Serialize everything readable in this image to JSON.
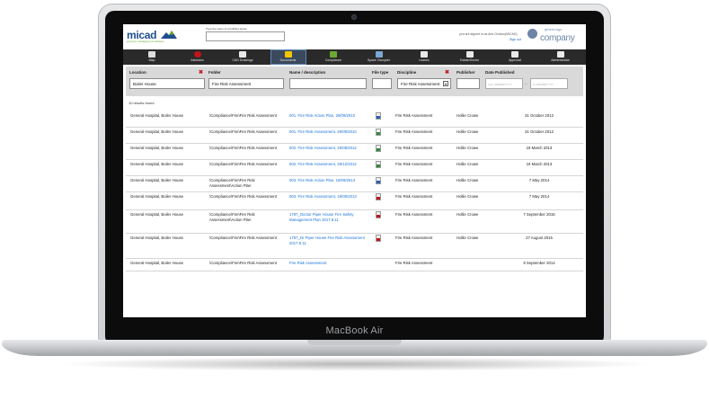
{
  "device": {
    "brand": "MacBook Air"
  },
  "app": {
    "logo_text": "micad",
    "logo_sub": "property management software",
    "search_label": "Type the name of a building below",
    "search_placeholder": "",
    "signed_in": "you are signed in as Ann Gordon(MICAD)",
    "sign_out": "Sign out",
    "company_small": "generic logo",
    "company_name": "company"
  },
  "nav": [
    {
      "label": "Map",
      "icon": "map-icon",
      "active": false
    },
    {
      "label": "Asbestos",
      "icon": "asbestos-icon",
      "active": false
    },
    {
      "label": "CAD Drawings",
      "icon": "cad-drawing-icon",
      "active": false
    },
    {
      "label": "Documents",
      "icon": "documents-icon",
      "active": true
    },
    {
      "label": "Compliance",
      "icon": "compliance-check-icon",
      "active": false
    },
    {
      "label": "Space Occupier",
      "icon": "space-occupier-icon",
      "active": false
    },
    {
      "label": "Leases",
      "icon": "leases-icon",
      "active": false
    },
    {
      "label": "Estate/Sector",
      "icon": "estate-sector-icon",
      "active": false
    },
    {
      "label": "Approval",
      "icon": "approval-icon",
      "active": false
    },
    {
      "label": "Administrator",
      "icon": "administrator-icon",
      "active": false
    }
  ],
  "filters": {
    "location_label": "Location",
    "location_value": "Boiler House",
    "folder_label": "Folder",
    "folder_value": "Fire Risk Assessment",
    "name_label": "Name / description",
    "name_value": "",
    "filetype_label": "File type",
    "filetype_value": "",
    "discipline_label": "Discipline",
    "discipline_value": "Fire Risk Assessment",
    "publisher_label": "Publisher",
    "publisher_value": "",
    "date_label": "Date Published",
    "date_from_placeholder": "from: DD/MM/YYYY",
    "date_to_placeholder": "to: DD/MM/YYYY"
  },
  "results_text": "10 results found",
  "rows": [
    {
      "location": "General Hospital, Boiler House",
      "folder": "\\Compliance\\Fire\\Fire Risk Assessment",
      "name": "001. Fire Risk Action Plan, 29/09/2010",
      "filetype": "word",
      "discipline": "Fire Risk Assessment",
      "publisher": "Hollie Crowe",
      "date": "31 October 2012"
    },
    {
      "location": "General Hospital, Boiler House",
      "folder": "\\Compliance\\Fire\\Fire Risk Assessment",
      "name": "001. Fire Risk Assessment, 29/09/2010",
      "filetype": "excel",
      "discipline": "Fire Risk Assessment",
      "publisher": "Hollie Crowe",
      "date": "31 October 2012"
    },
    {
      "location": "General Hospital, Boiler House",
      "folder": "\\Compliance\\Fire\\Fire Risk Assessment",
      "name": "002. Fire Risk Assessment, 29/09/2012",
      "filetype": "excel",
      "discipline": "Fire Risk Assessment",
      "publisher": "Hollie Crowe",
      "date": "19 March 2013"
    },
    {
      "location": "General Hospital, Boiler House",
      "folder": "\\Compliance\\Fire\\Fire Risk Assessment",
      "name": "002. Fire Risk Assessment, 28/12/2012",
      "filetype": "excel",
      "discipline": "Fire Risk Assessment",
      "publisher": "Hollie Crowe",
      "date": "19 March 2013"
    },
    {
      "location": "General Hospital, Boiler House",
      "folder": "\\Compliance\\Fire\\Fire Risk Assessment\\Action Plan",
      "name": "003. Fire Risk Action Plan, 19/09/2013",
      "filetype": "word",
      "discipline": "Fire Risk Assessment",
      "publisher": "Hollie Crowe",
      "date": "7 May 2014"
    },
    {
      "location": "General Hospital, Boiler House",
      "folder": "\\Compliance\\Fire\\Fire Risk Assessment",
      "name": "003. Fire Risk Assessment, 19/09/2013",
      "filetype": "pdf",
      "discipline": "Fire Risk Assessment",
      "publisher": "Hollie Crowe",
      "date": "7 May 2014"
    },
    {
      "location": "General Hospital, Boiler House",
      "folder": "\\Compliance\\Fire\\Fire Risk Assessment\\Action Plan",
      "name": "1787_Doctor Piper House Fire Safety Management Plan 2017.8.11",
      "filetype": "pdf",
      "discipline": "Fire Risk Assessment",
      "publisher": "Hollie Crowe",
      "date": "7 September 2015"
    },
    {
      "location": "General Hospital, Boiler House",
      "folder": "\\Compliance\\Fire\\Fire Risk Assessment",
      "name": "1787_Dr Piper House Fire Risk Assessment 2017.8.11",
      "filetype": "pdf",
      "discipline": "Fire Risk Assessment",
      "publisher": "Hollie Crowe",
      "date": "27 August 2015"
    },
    {
      "location": "General Hospital, Boiler House",
      "folder": "\\Compliance\\Fire\\Fire Risk Assessment",
      "name": "Fire Risk Assessment",
      "filetype": "none",
      "discipline": "Fire Risk Assessment",
      "publisher": "",
      "date": "9 September 2014"
    }
  ],
  "colors": {
    "nav_bg": "#2a2a2a",
    "link": "#1a73d6",
    "word": "#2b5fb3",
    "excel": "#2e8b3a",
    "pdf": "#c0161b"
  }
}
